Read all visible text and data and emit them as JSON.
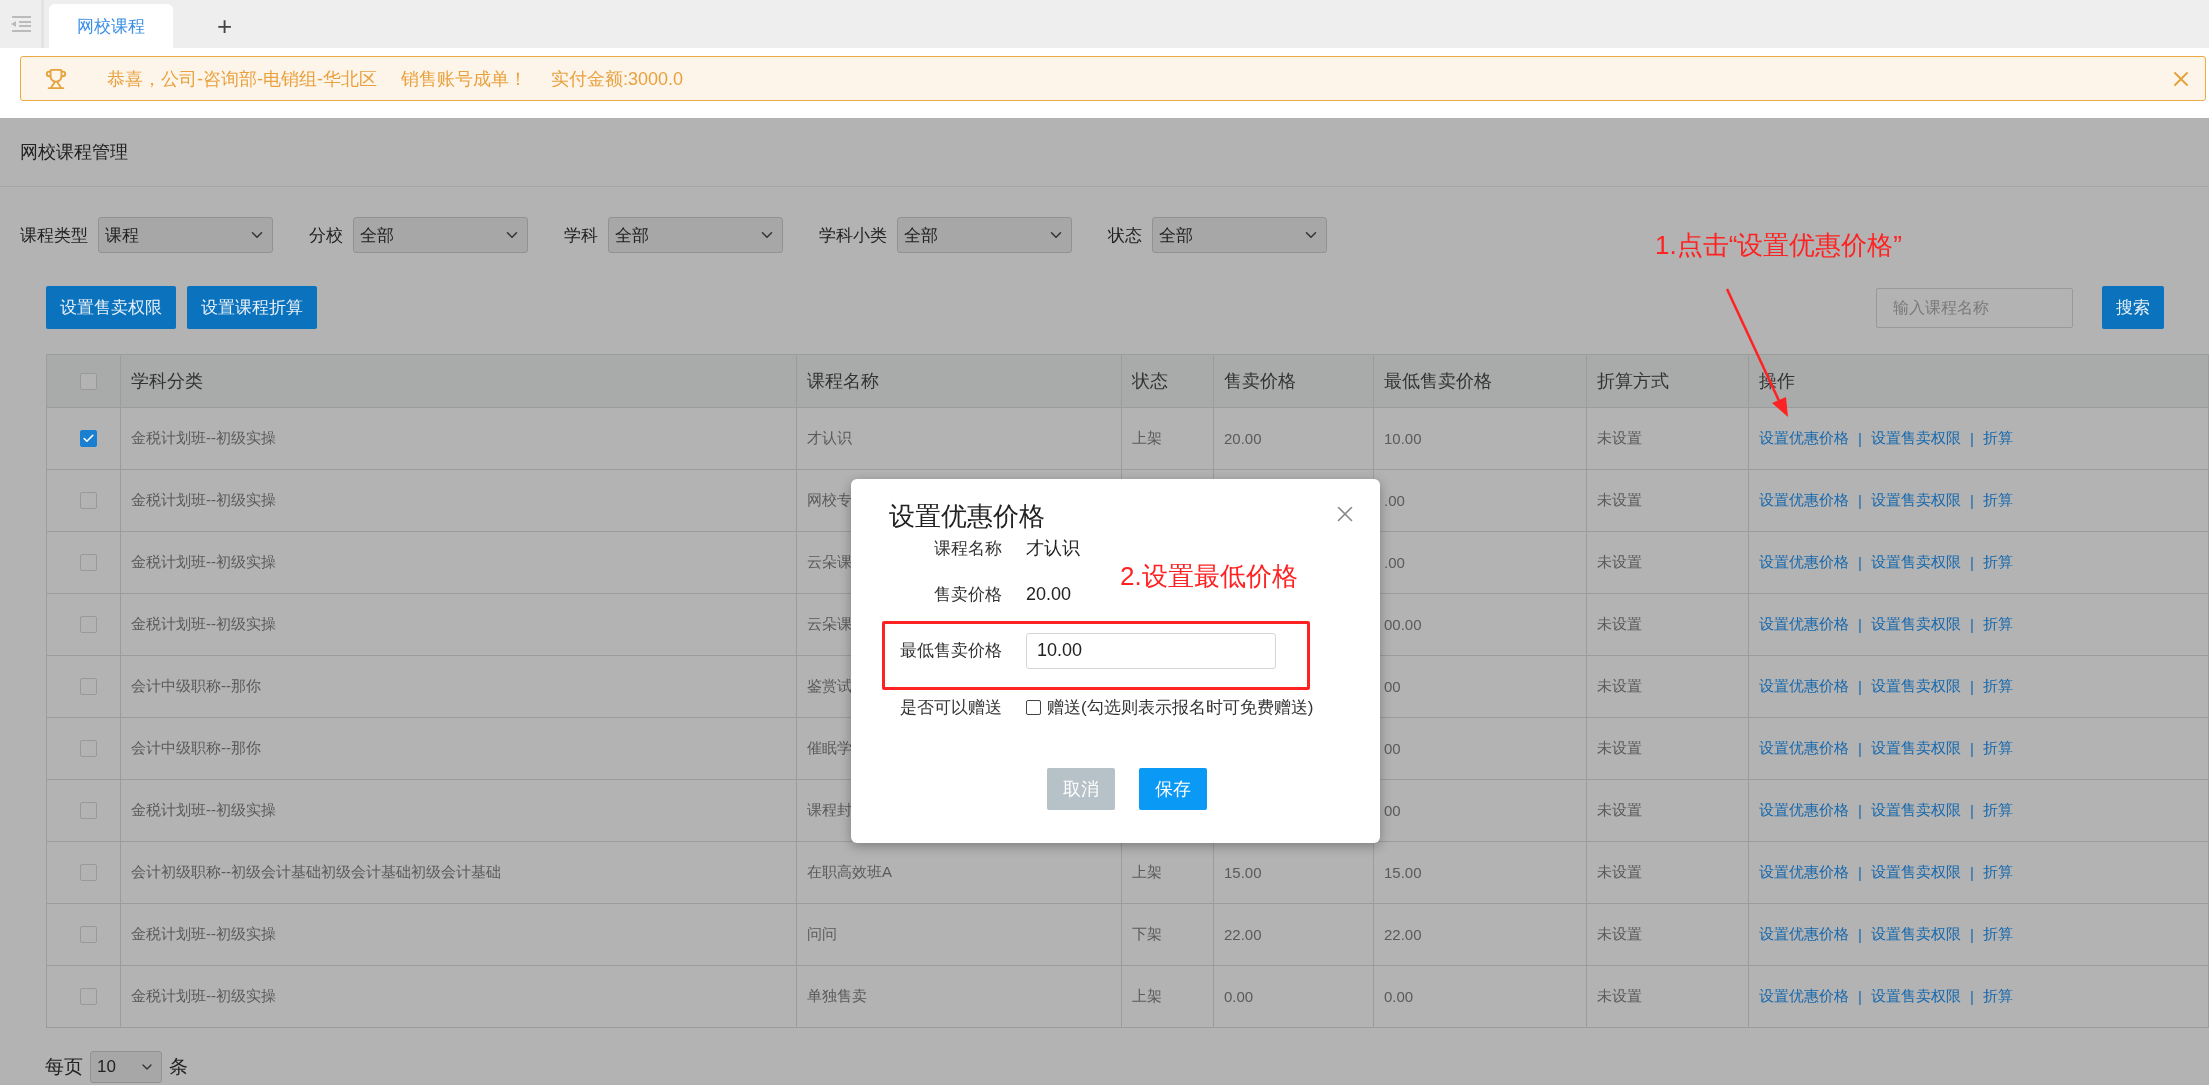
{
  "tab_bar": {
    "tabs": [
      {
        "label": "网校课程",
        "selected": true
      }
    ],
    "add_label": "+"
  },
  "notification": {
    "parts": [
      "恭喜，公司-咨询部-电销组-华北区",
      "销售账号成单！",
      "实付金额:3000.0"
    ]
  },
  "page_title": "网校课程管理",
  "filters": [
    {
      "label": "课程类型",
      "value": "课程"
    },
    {
      "label": "分校",
      "value": "全部"
    },
    {
      "label": "学科",
      "value": "全部"
    },
    {
      "label": "学科小类",
      "value": "全部"
    },
    {
      "label": "状态",
      "value": "全部"
    }
  ],
  "actions": [
    "设置售卖权限",
    "设置课程折算"
  ],
  "search": {
    "placeholder": "输入课程名称",
    "button": "搜索"
  },
  "table": {
    "columns": [
      "学科分类",
      "课程名称",
      "状态",
      "售卖价格",
      "最低售卖价格",
      "折算方式",
      "操作"
    ],
    "header_checked": false,
    "action_separator": "|",
    "rows": [
      {
        "checked": true,
        "category": "金税计划班--初级实操",
        "course": "才认识",
        "status": "上架",
        "price": "20.00",
        "min_price": "10.00",
        "conversion": "未设置",
        "actions": [
          "设置优惠价格",
          "设置售卖权限",
          "折算"
        ]
      },
      {
        "checked": false,
        "category": "金税计划班--初级实操",
        "course": "网校专",
        "min_price": ".00",
        "conversion": "未设置",
        "actions": [
          "设置优惠价格",
          "设置售卖权限",
          "折算"
        ]
      },
      {
        "checked": false,
        "category": "金税计划班--初级实操",
        "course": "云朵课",
        "min_price": ".00",
        "conversion": "未设置",
        "actions": [
          "设置优惠价格",
          "设置售卖权限",
          "折算"
        ]
      },
      {
        "checked": false,
        "category": "金税计划班--初级实操",
        "course": "云朵课",
        "min_price": "00.00",
        "conversion": "未设置",
        "actions": [
          "设置优惠价格",
          "设置售卖权限",
          "折算"
        ]
      },
      {
        "checked": false,
        "category": "会计中级职称--那你",
        "course": "鉴赏试",
        "min_price": "00",
        "conversion": "未设置",
        "actions": [
          "设置优惠价格",
          "设置售卖权限",
          "折算"
        ]
      },
      {
        "checked": false,
        "category": "会计中级职称--那你",
        "course": "催眠学",
        "min_price": "00",
        "conversion": "未设置",
        "actions": [
          "设置优惠价格",
          "设置售卖权限",
          "折算"
        ]
      },
      {
        "checked": false,
        "category": "金税计划班--初级实操",
        "course": "课程封",
        "min_price": "00",
        "conversion": "未设置",
        "actions": [
          "设置优惠价格",
          "设置售卖权限",
          "折算"
        ]
      },
      {
        "checked": false,
        "category": "会计初级职称--初级会计基础初级会计基础初级会计基础",
        "course": "在职高效班A",
        "status": "上架",
        "price": "15.00",
        "min_price": "15.00",
        "conversion": "未设置",
        "actions": [
          "设置优惠价格",
          "设置售卖权限",
          "折算"
        ]
      },
      {
        "checked": false,
        "category": "金税计划班--初级实操",
        "course": "问问",
        "status": "下架",
        "price": "22.00",
        "min_price": "22.00",
        "conversion": "未设置",
        "actions": [
          "设置优惠价格",
          "设置售卖权限",
          "折算"
        ]
      },
      {
        "checked": false,
        "category": "金税计划班--初级实操",
        "course": "单独售卖",
        "status": "上架",
        "price": "0.00",
        "min_price": "0.00",
        "conversion": "未设置",
        "actions": [
          "设置优惠价格",
          "设置售卖权限",
          "折算"
        ]
      }
    ]
  },
  "pagination": {
    "label": "每页",
    "value": "10",
    "unit": "条"
  },
  "modal": {
    "title": "设置优惠价格",
    "fields": [
      {
        "kind": "text",
        "label": "课程名称",
        "value": "才认识"
      },
      {
        "kind": "text",
        "label": "售卖价格",
        "value": "20.00"
      },
      {
        "kind": "input",
        "label": "最低售卖价格",
        "value": "10.00"
      },
      {
        "kind": "checkbox",
        "label": "是否可以赠送",
        "option": "赠送(勾选则表示报名时可免费赠送)",
        "checked": false
      }
    ],
    "buttons": [
      {
        "label": "取消",
        "kind": "secondary"
      },
      {
        "label": "保存",
        "kind": "primary"
      }
    ]
  },
  "annotations": {
    "step_1": "1.点击“设置优惠价格”",
    "step_2": "2.设置最低价格"
  }
}
